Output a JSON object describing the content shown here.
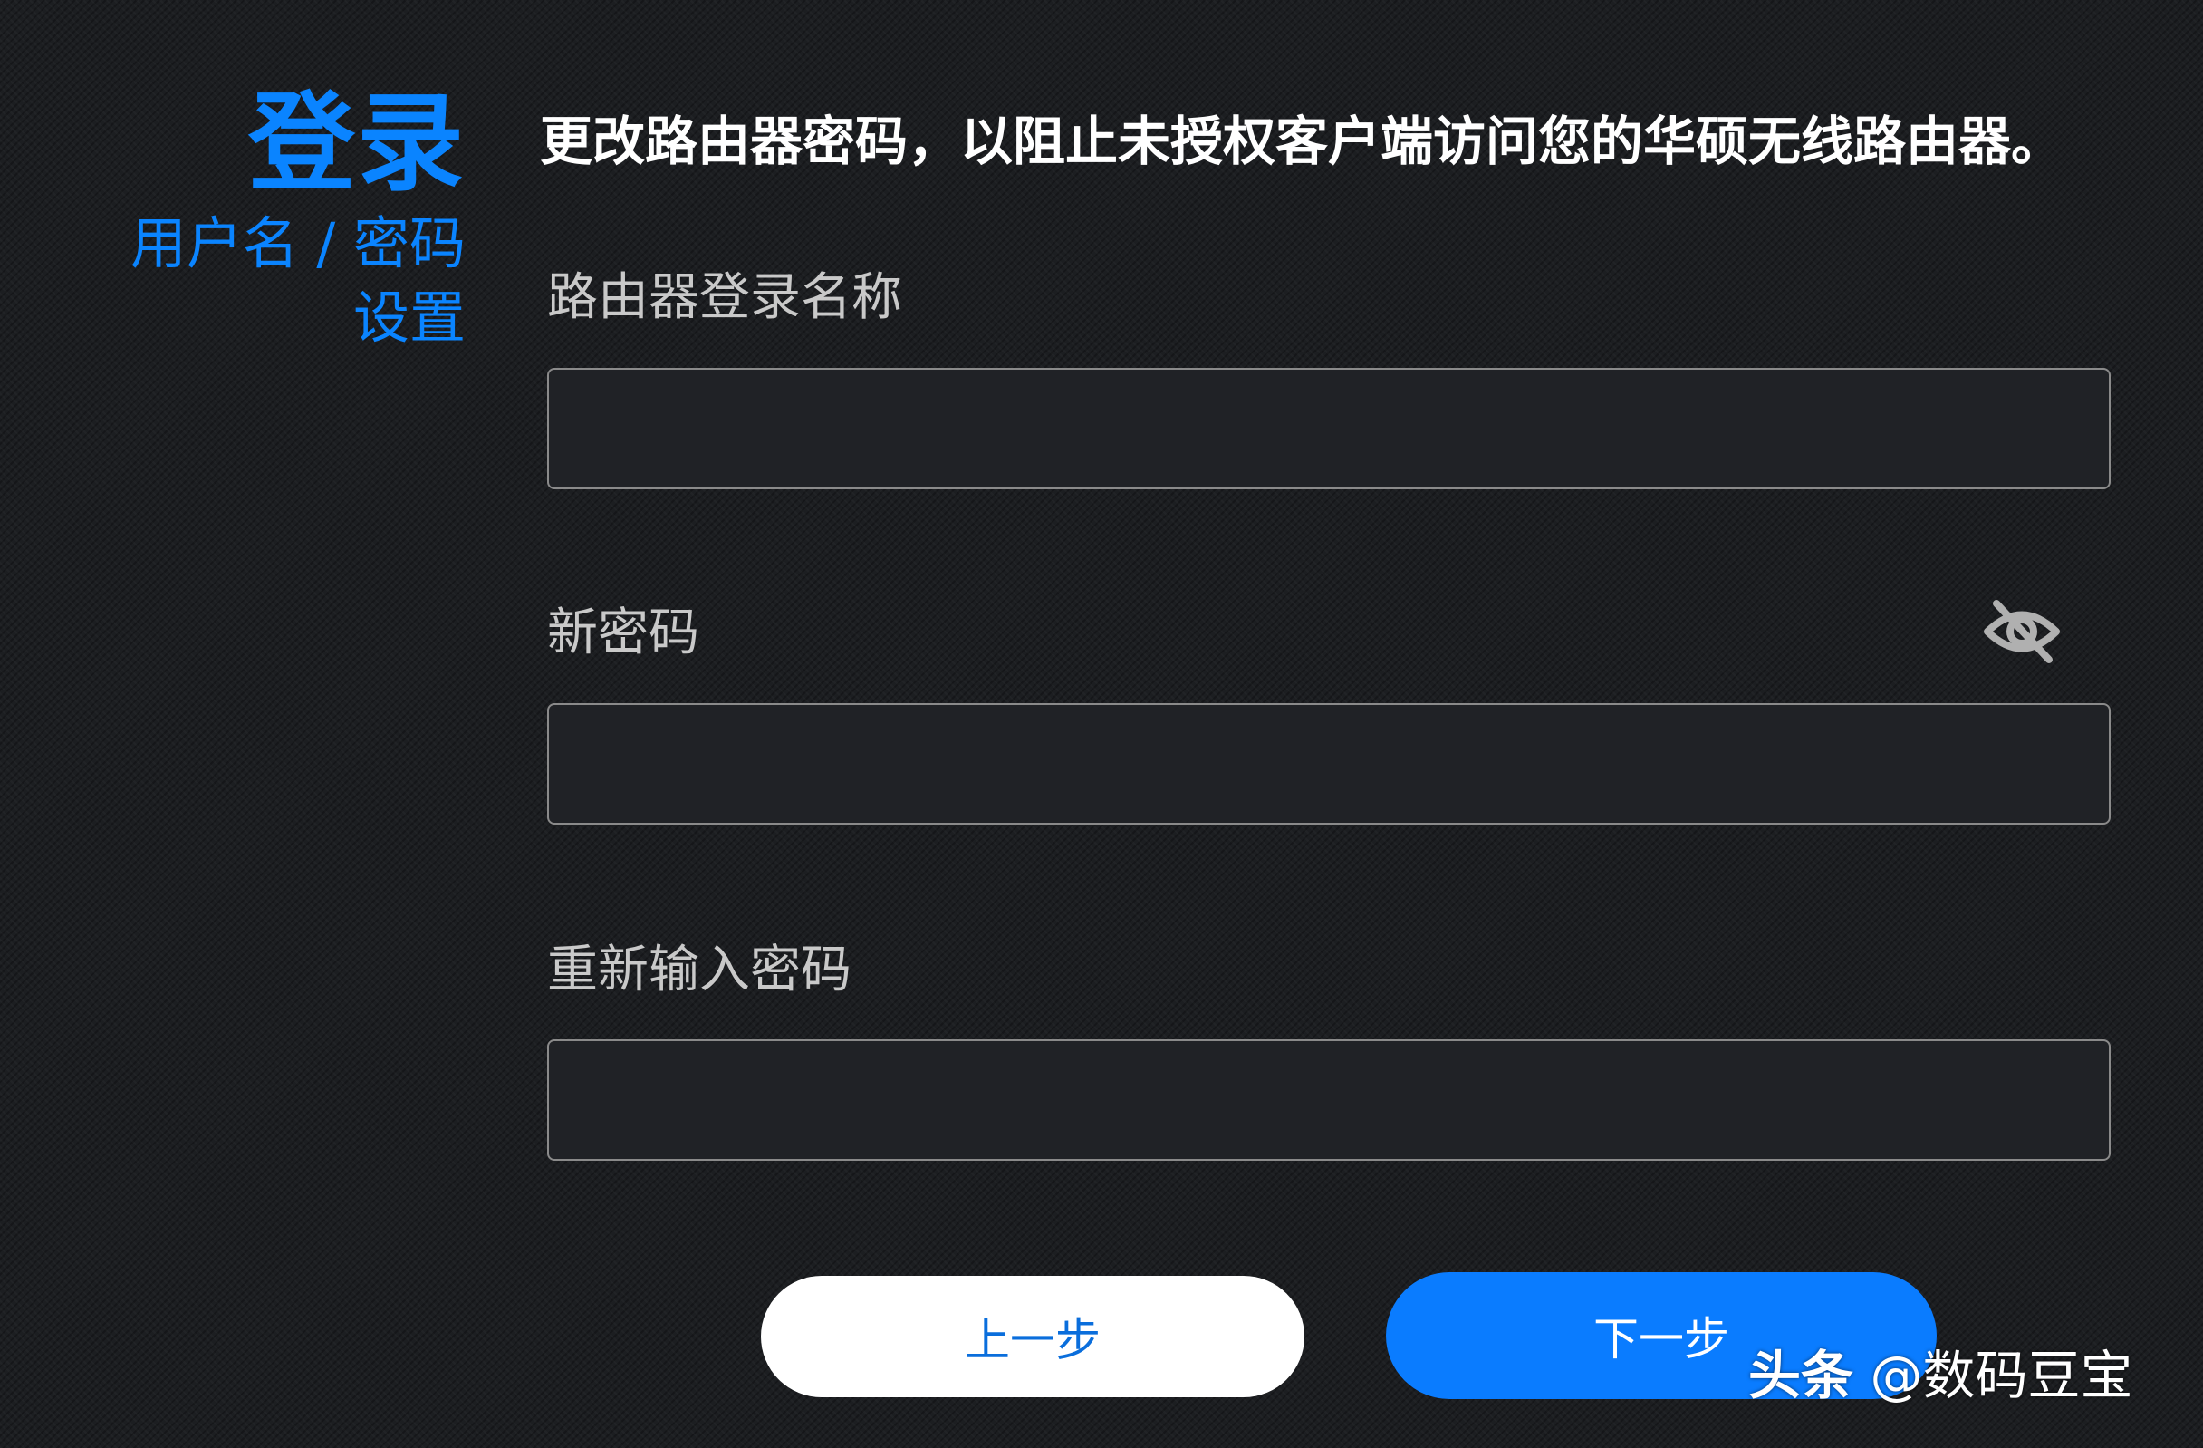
{
  "sidebar": {
    "title": "登录",
    "subtitle_line1": "用户名 / 密码",
    "subtitle_line2": "设置"
  },
  "headline": "更改路由器密码，以阻止未授权客户端访问您的华硕无线路由器。",
  "form": {
    "login_name_label": "路由器登录名称",
    "login_name_value": "",
    "new_password_label": "新密码",
    "new_password_value": "",
    "confirm_password_label": "重新输入密码",
    "confirm_password_value": ""
  },
  "buttons": {
    "prev_label": "上一步",
    "next_label": "下一步"
  },
  "watermark": {
    "brand": "头条",
    "handle": "@数码豆宝"
  },
  "colors": {
    "accent": "#0a84ff",
    "background": "#1c1e21",
    "next_button": "#0a7cff"
  },
  "icons": {
    "password_visibility": "eye-slash-icon"
  }
}
